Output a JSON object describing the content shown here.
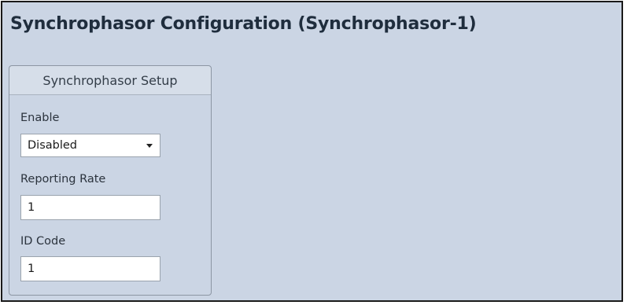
{
  "page": {
    "title": "Synchrophasor Configuration (Synchrophasor-1)"
  },
  "setup": {
    "header": "Synchrophasor Setup",
    "enable": {
      "label": "Enable",
      "selected": "Disabled"
    },
    "reporting_rate": {
      "label": "Reporting Rate",
      "value": "1"
    },
    "id_code": {
      "label": "ID Code",
      "value": "1"
    }
  },
  "icons": {
    "dropdown": "chevron-down-icon"
  },
  "colors": {
    "background": "#cbd5e4",
    "title_text": "#1f2d3d",
    "border": "#1a1a1a"
  }
}
